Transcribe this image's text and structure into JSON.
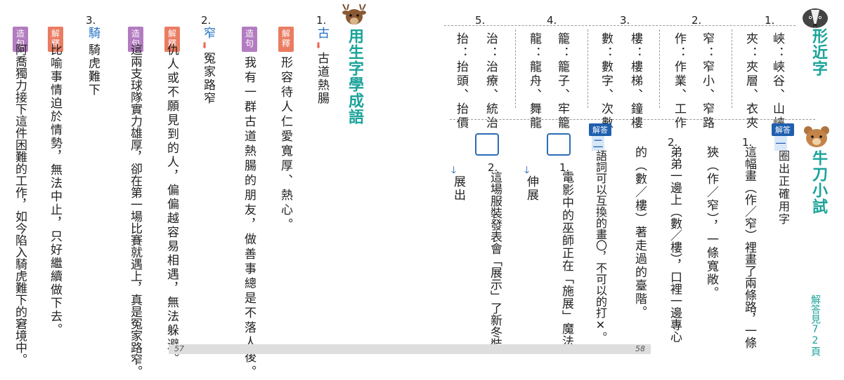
{
  "left_page": {
    "section_title": "用生字學成語",
    "item1": {
      "number": "1.",
      "char": "古",
      "word": "古道熱腸",
      "tag_explain": "解釋",
      "explain": "形容待人仁愛寬厚、熱心。",
      "tag_sentence": "造句",
      "sentence": "我有一群古道熱腸的朋友，做善事總是不落人後。",
      "sentence_hl": "古道熱腸"
    },
    "item2": {
      "number": "2.",
      "char": "窄",
      "word": "冤家路窄",
      "tag_explain": "解釋",
      "explain_lines": [
        "仇人或不願見到的人，偏偏越容易相遇，無法躲避。"
      ],
      "tag_sentence": "造句",
      "sentence_lines": [
        "這兩支球隊實力雄厚，卻在第一場比賽就遇上，真是冤家路窄。"
      ]
    },
    "item3": {
      "number": "3.",
      "char": "騎",
      "word": "騎虎難下",
      "tag_explain": "解釋",
      "explain_lines": [
        "比喻事情迫於情勢，無法中止，只好繼續做下去。"
      ],
      "tag_sentence": "造句",
      "sentence_lines": [
        "阿喬獨力接下這件困難的工作，如今陷入騎虎難下的窘境中。"
      ]
    },
    "page_number": "57"
  },
  "right_page": {
    "section_title": "形近字",
    "groups": [
      {
        "number": "1.",
        "lines": [
          "峽：峽谷、山峽",
          "夾：夾層、衣夾"
        ]
      },
      {
        "number": "2.",
        "lines": [
          "窄：窄小、窄路",
          "作：作業、工作"
        ]
      },
      {
        "number": "3.",
        "lines": [
          "樓：樓梯、鐘樓",
          "數：數字、次數"
        ]
      },
      {
        "number": "4.",
        "lines": [
          "籠：籠子、牢籠",
          "龍：龍舟、舞龍"
        ]
      },
      {
        "number": "5.",
        "lines": [
          "治：治療、統治",
          "抬：抬頭、抬價"
        ]
      }
    ],
    "quiz_title": "牛刀小試",
    "answer_badge": "解答",
    "q1_heading": "一",
    "q1_instr": "圈出正確用字",
    "q1_1_num": "1.",
    "q1_1_a": "這幅畫（作／窄）裡畫了兩條路，一條",
    "q1_1_b": "狹（作／窄），一條寬敞。",
    "q1_2_num": "2.",
    "q1_2_a": "弟弟一邊上（數／樓），口裡一邊專心",
    "q1_2_b": "的（數／樓）著走過的臺階。",
    "q2_heading": "二",
    "q2_instr": "語詞可以互換的畫〇，不可以的打✕。",
    "q2_1_num": "1.",
    "q2_1": "電影中的巫師正在「施展」魔法。",
    "q2_1_opt": "伸展",
    "q2_2_num": "2.",
    "q2_2": "這場服裝發表會「展示」了新冬裝。",
    "q2_2_opt": "展出",
    "answers_ref": "解答見72頁",
    "page_number": "58"
  },
  "colors": {
    "teal": "#1aa39a",
    "blue": "#1f6fc2",
    "explain_tag": "#ea7c62",
    "sentence_tag": "#b37cc0",
    "answer_badge": "#1f5fae"
  }
}
